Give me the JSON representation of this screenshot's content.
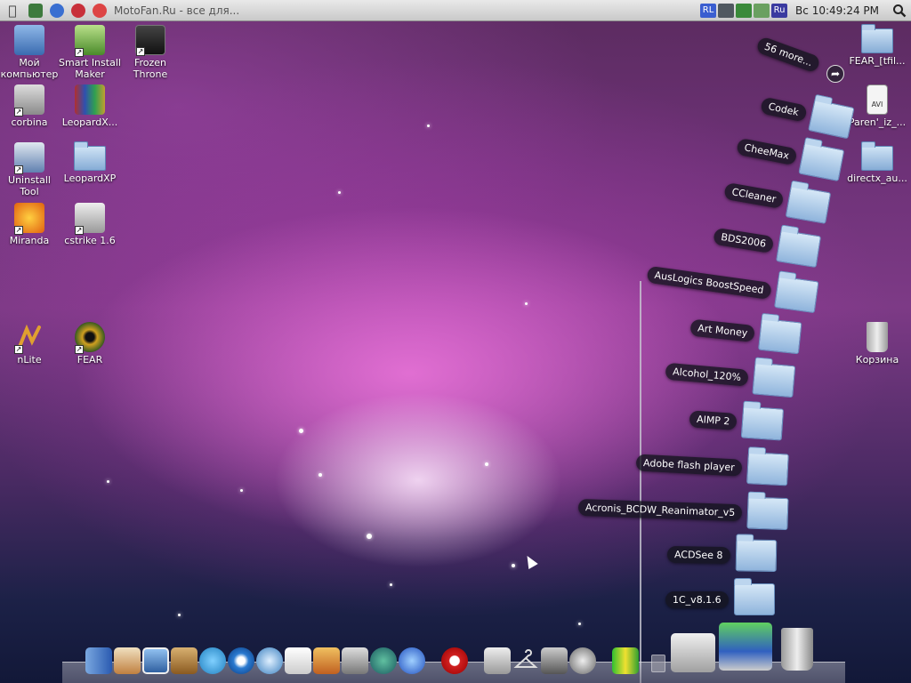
{
  "menubar": {
    "window_title": "MotoFan.Ru - все для...",
    "tray_items": [
      "RL",
      "Ru"
    ],
    "clock": "Вс 10:49:24 PM"
  },
  "desktop_icons_left": [
    {
      "label": "Мой компьютер",
      "icon": "computer-icon"
    },
    {
      "label": "Smart Install Maker",
      "icon": "installer-icon"
    },
    {
      "label": "Frozen Throne",
      "icon": "warcraft-icon"
    },
    {
      "label": "corbina",
      "icon": "network-icon"
    },
    {
      "label": "LeopardX...",
      "icon": "archive-icon"
    },
    {
      "label": "Uninstall Tool",
      "icon": "uninstall-icon"
    },
    {
      "label": "LeopardXP",
      "icon": "folder-icon"
    },
    {
      "label": "Miranda",
      "icon": "miranda-icon"
    },
    {
      "label": "cstrike 1.6",
      "icon": "counter-strike-icon"
    },
    {
      "label": "nLite",
      "icon": "nlite-icon"
    },
    {
      "label": "FEAR",
      "icon": "fear-eye-icon"
    }
  ],
  "desktop_icons_right": [
    {
      "label": "FEAR_[tfil...",
      "icon": "folder-icon"
    },
    {
      "label": "Paren'_iz_...",
      "icon": "avi-file-icon"
    },
    {
      "label": "directx_au...",
      "icon": "folder-icon"
    },
    {
      "label": "Корзина",
      "icon": "trash-icon"
    }
  ],
  "stack": {
    "more_label": "56 more...",
    "items": [
      "Codek",
      "CheeMax",
      "CCleaner",
      "BDS2006",
      "AusLogics BoostSpeed",
      "Art Money",
      "Alcohol_120%",
      "AIMP 2",
      "Adobe flash player",
      "Acronis_BCDW_Reanimator_v5",
      "ACDSee 8",
      "1C_v8.1.6"
    ]
  },
  "dock_items": [
    "finder-icon",
    "home-icon",
    "photo-icon",
    "address-book-icon",
    "messenger-icon",
    "media-player-icon",
    "browser-icon",
    "notes-icon",
    "app-store-icon",
    "calculator-icon",
    "network-globe-icon",
    "internet-globe-icon",
    "opera-icon",
    "script-icon",
    "hanger-icon",
    "terminal-icon",
    "power-icon",
    "equalizer-icon"
  ],
  "colors": {
    "menubar": "#d9d9d9",
    "folder": "#9dbde3",
    "pill": "#1a1a26"
  }
}
